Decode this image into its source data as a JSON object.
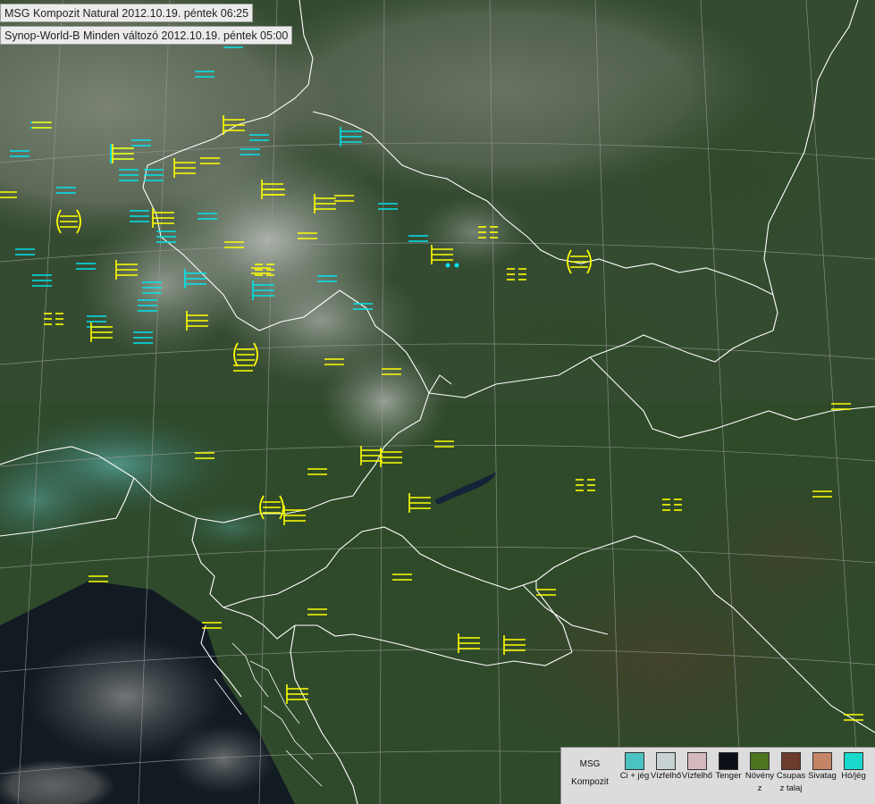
{
  "title_line1": "MSG Kompozit Natural 2012.10.19. péntek 06:25",
  "title_line2": "Synop-World-B Minden változó 2012.10.19. péntek 05:00",
  "colors": {
    "yellow_symbol": "#ffff00",
    "cyan_symbol": "#00e5ee",
    "border": "#ffffff",
    "graticule": "#8a8a8a"
  },
  "legend": {
    "title": "MSG Kompozit",
    "items": [
      {
        "label": "Ci + jég",
        "color": "#4cc3c3"
      },
      {
        "label": "Vízfelhő",
        "color": "#c7d2d2"
      },
      {
        "label": "Vízfelhő",
        "color": "#d6b9bd"
      },
      {
        "label": "Tenger",
        "color": "#0b0f18"
      },
      {
        "label": "Növényz",
        "color": "#4d7420"
      },
      {
        "label": "Csupasz talaj",
        "color": "#6b3c2c"
      },
      {
        "label": "Sivatag",
        "color": "#c48466"
      },
      {
        "label": "Hó/jég",
        "color": "#19d9cc"
      }
    ]
  },
  "icons": {
    "fog_symbol": "fog-icon",
    "fog_with_sky": "fog-sky-visible-icon",
    "mist_symbol": "mist-icon",
    "drizzle_dots": "drizzle-icon"
  }
}
